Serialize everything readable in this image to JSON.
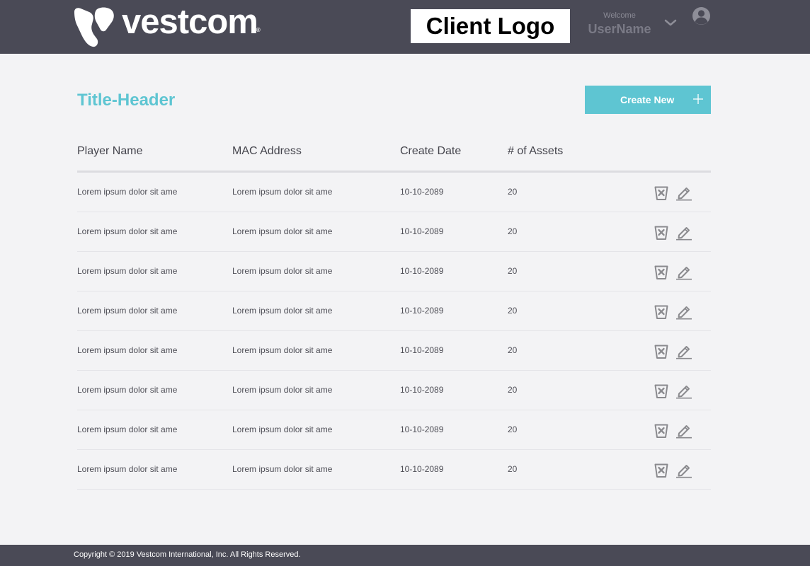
{
  "header": {
    "brand_name": "vestcom",
    "brand_reg": "®",
    "client_logo": "Client Logo",
    "welcome_label": "Welcome",
    "username": "UserName",
    "icons": [
      "vestcom-logo-icon",
      "chevron-down-icon",
      "user-avatar-icon"
    ]
  },
  "main": {
    "title": "Title-Header",
    "create_button": "Create New",
    "create_icon": "plus-icon"
  },
  "table": {
    "columns": [
      "Player Name",
      "MAC Address",
      "Create Date",
      "# of Assets"
    ],
    "rows": [
      {
        "player": "Lorem ipsum dolor sit ame",
        "mac": "Lorem ipsum dolor sit ame",
        "date": "10-10-2089",
        "assets": "20"
      },
      {
        "player": "Lorem ipsum dolor sit ame",
        "mac": "Lorem ipsum dolor sit ame",
        "date": "10-10-2089",
        "assets": "20"
      },
      {
        "player": "Lorem ipsum dolor sit ame",
        "mac": "Lorem ipsum dolor sit ame",
        "date": "10-10-2089",
        "assets": "20"
      },
      {
        "player": "Lorem ipsum dolor sit ame",
        "mac": "Lorem ipsum dolor sit ame",
        "date": "10-10-2089",
        "assets": "20"
      },
      {
        "player": "Lorem ipsum dolor sit ame",
        "mac": "Lorem ipsum dolor sit ame",
        "date": "10-10-2089",
        "assets": "20"
      },
      {
        "player": "Lorem ipsum dolor sit ame",
        "mac": "Lorem ipsum dolor sit ame",
        "date": "10-10-2089",
        "assets": "20"
      },
      {
        "player": "Lorem ipsum dolor sit ame",
        "mac": "Lorem ipsum dolor sit ame",
        "date": "10-10-2089",
        "assets": "20"
      },
      {
        "player": "Lorem ipsum dolor sit ame",
        "mac": "Lorem ipsum dolor sit ame",
        "date": "10-10-2089",
        "assets": "20"
      }
    ],
    "row_icons": [
      "delete-icon",
      "edit-icon"
    ]
  },
  "footer": {
    "copyright": "Copyright © 2019 Vestcom International, Inc. All Rights Reserved."
  },
  "colors": {
    "header_bg": "#4a4a56",
    "accent": "#5ec5d2",
    "page_bg": "#f3f3f5",
    "icon_gray": "#8a8a8e"
  }
}
